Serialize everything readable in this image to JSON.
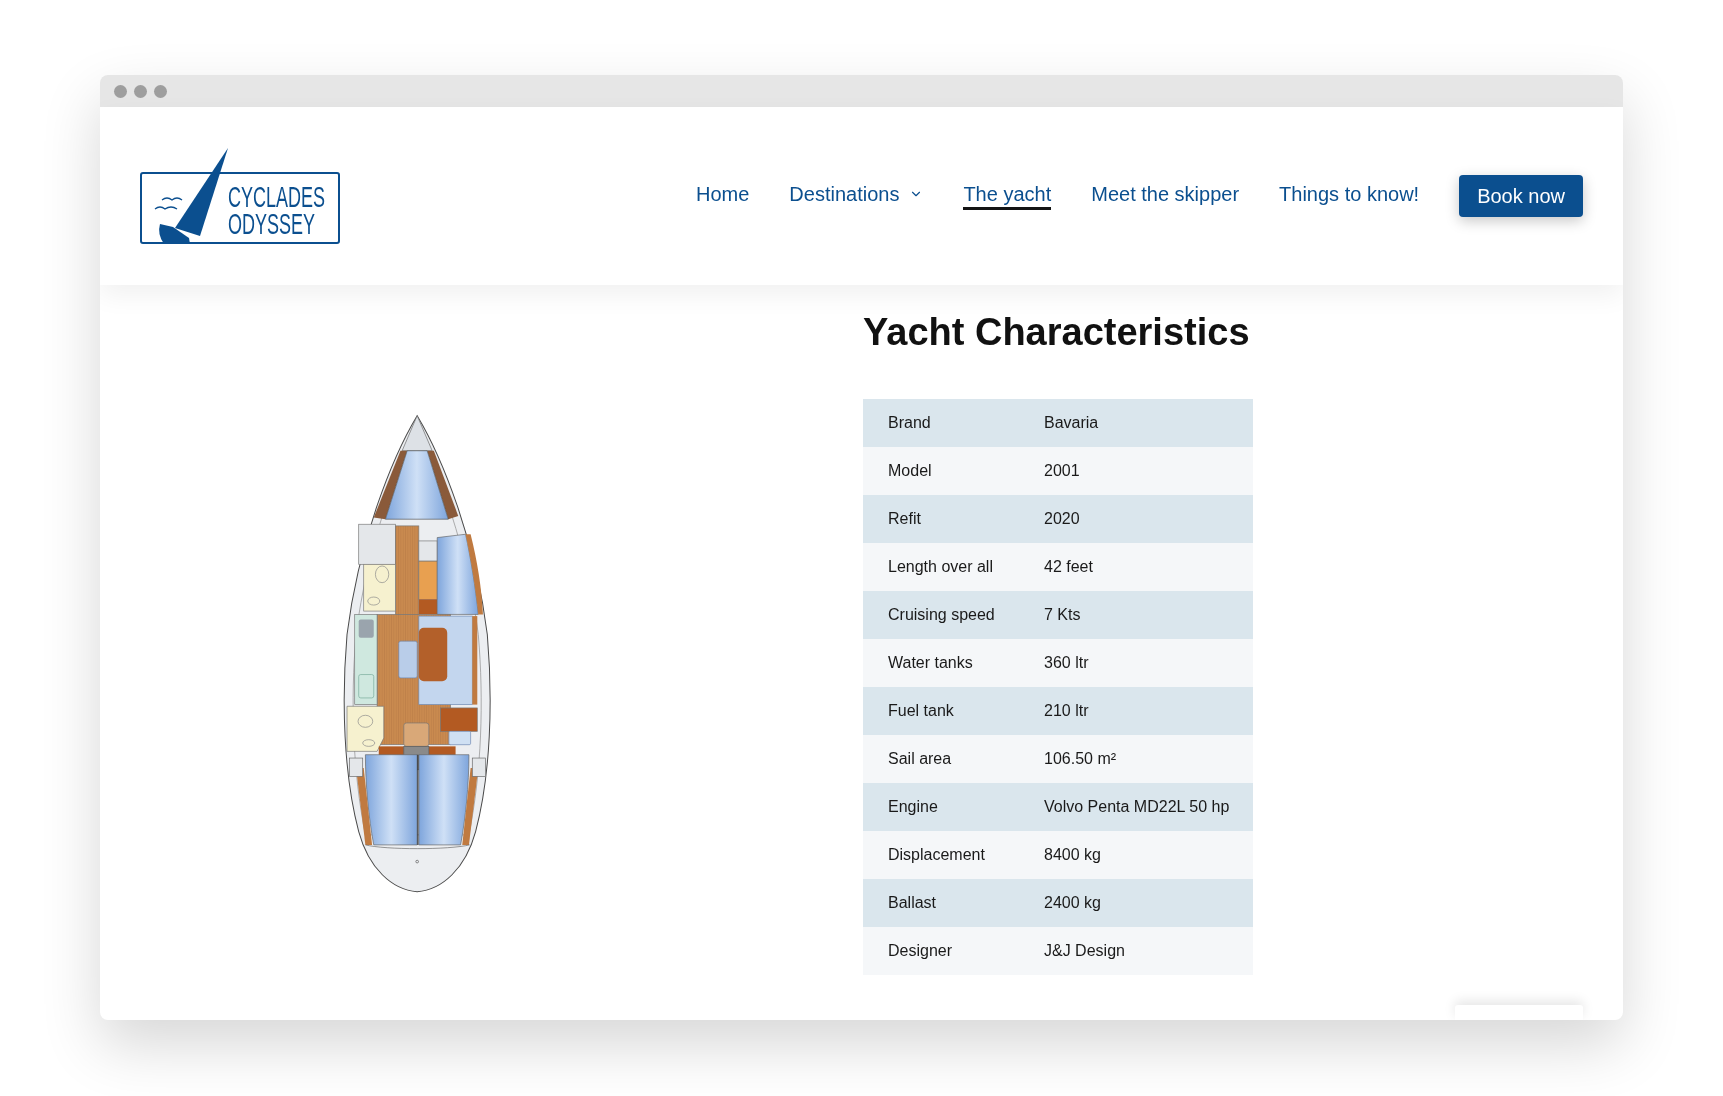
{
  "header": {
    "logo": {
      "lines": [
        "CYCLADES",
        "ODYSSEY"
      ]
    },
    "nav": [
      {
        "label": "Home",
        "selected": false,
        "dropdown": false
      },
      {
        "label": "Destinations",
        "selected": false,
        "dropdown": true
      },
      {
        "label": "The yacht",
        "selected": true,
        "dropdown": false
      },
      {
        "label": "Meet the skipper",
        "selected": false,
        "dropdown": false
      },
      {
        "label": "Things to know!",
        "selected": false,
        "dropdown": false
      }
    ],
    "cta": {
      "label": "Book now"
    }
  },
  "main": {
    "title": "Yacht Characteristics",
    "specs": [
      {
        "label": "Brand",
        "value": "Bavaria"
      },
      {
        "label": "Model",
        "value": "2001"
      },
      {
        "label": "Refit",
        "value": "2020"
      },
      {
        "label": "Length over all",
        "value": "42 feet"
      },
      {
        "label": "Cruising speed",
        "value": "7 Kts"
      },
      {
        "label": "Water tanks",
        "value": "360 ltr"
      },
      {
        "label": "Fuel tank",
        "value": "210 ltr"
      },
      {
        "label": "Sail area",
        "value": "106.50 m²"
      },
      {
        "label": "Engine",
        "value": "Volvo Penta MD22L 50 hp"
      },
      {
        "label": "Displacement",
        "value": "8400 kg"
      },
      {
        "label": "Ballast",
        "value": "2400 kg"
      },
      {
        "label": "Designer",
        "value": "J&J Design"
      }
    ]
  }
}
